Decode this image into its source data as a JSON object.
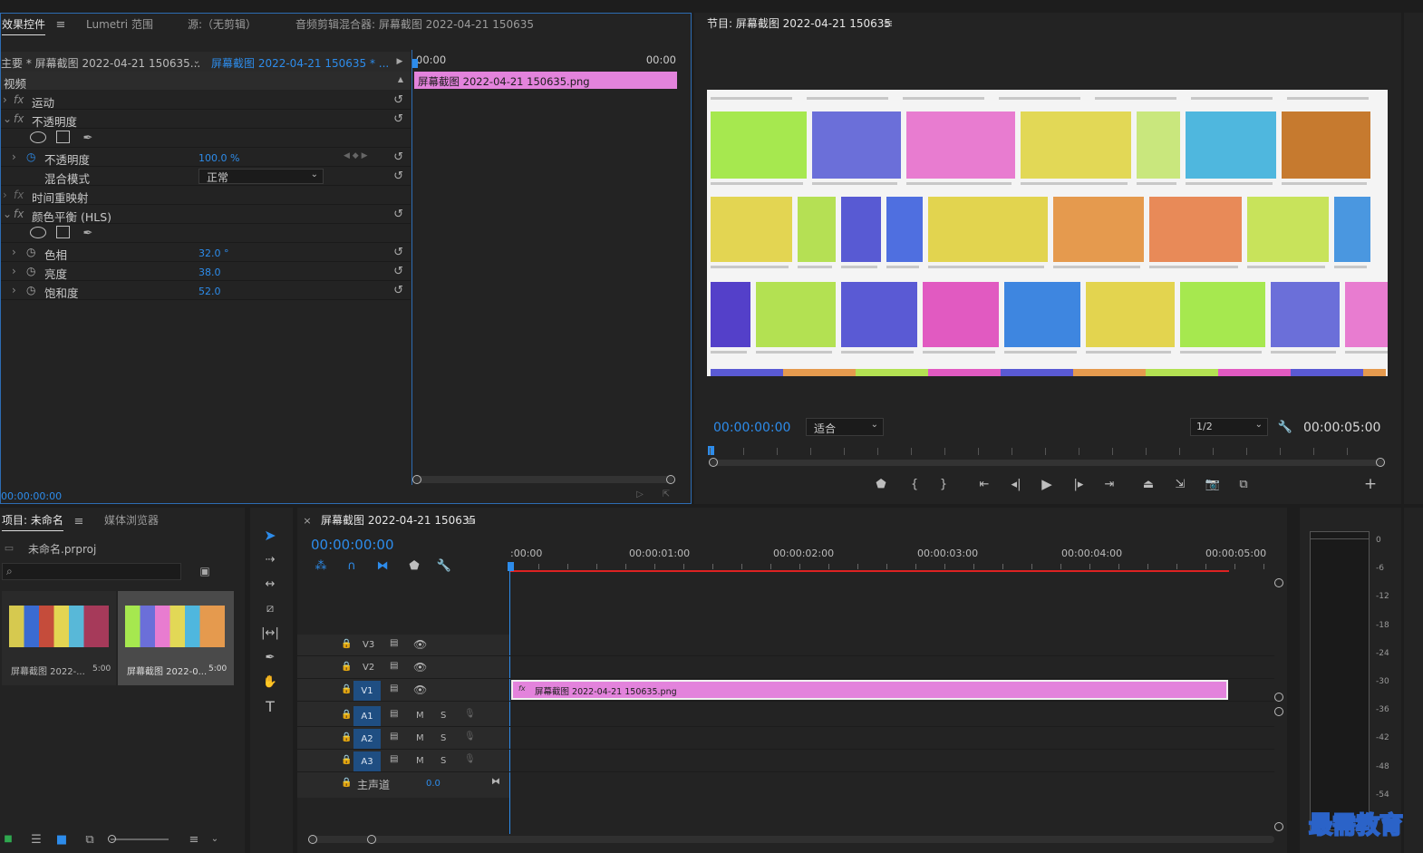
{
  "effect_controls": {
    "tabs": [
      "效果控件",
      "Lumetri 范围",
      "源:（无剪辑）",
      "音频剪辑混合器: 屏幕截图 2022-04-21 150635"
    ],
    "master_label": "主要 * 屏幕截图 2022-04-21 150635...",
    "clip_label": "屏幕截图 2022-04-21 150635 * ...",
    "section_video": "视频",
    "effects": {
      "motion": "运动",
      "opacity": "不透明度",
      "opacity_prop": "不透明度",
      "opacity_value": "100.0 %",
      "blend_mode_label": "混合模式",
      "blend_mode_value": "正常",
      "time_remap": "时间重映射",
      "color_balance": "颜色平衡 (HLS)",
      "hue": "色相",
      "hue_value": "32.0 °",
      "lightness": "亮度",
      "lightness_value": "38.0",
      "saturation": "饱和度",
      "saturation_value": "52.0"
    },
    "mini_timeline": {
      "start": "00:00",
      "end": "00:00",
      "clip": "屏幕截图 2022-04-21 150635.png"
    },
    "timecode": "00:00:00:00"
  },
  "program_monitor": {
    "title": "节目: 屏幕截图 2022-04-21 150635",
    "timecode": "00:00:00:00",
    "fit": "适合",
    "resolution": "1/2",
    "duration": "00:00:05:00",
    "preview_colors": [
      "#a6e84f",
      "#6b6fd9",
      "#e87cd0",
      "#e2d856",
      "#c9e77d",
      "#4fb7de",
      "#c67a2f",
      "#e3d552",
      "#b5e054",
      "#585ad3",
      "#4f6fe0",
      "#e2d44f",
      "#e59a4e",
      "#e88a58",
      "#c8e35b",
      "#4a97e0",
      "#5440c9",
      "#b3e152",
      "#5a5ad4",
      "#e15ac1",
      "#3e86e0",
      "#e3d44f"
    ]
  },
  "project": {
    "tabs": [
      "项目: 未命名",
      "媒体浏览器"
    ],
    "file": "未命名.prproj",
    "items": [
      {
        "name": "屏幕截图 2022-...",
        "duration": "5:00"
      },
      {
        "name": "屏幕截图 2022-0...",
        "duration": "5:00"
      }
    ]
  },
  "timeline": {
    "title": "屏幕截图 2022-04-21 150635",
    "timecode": "00:00:00:00",
    "ruler": [
      ":00:00",
      "00:00:01:00",
      "00:00:02:00",
      "00:00:03:00",
      "00:00:04:00",
      "00:00:05:00"
    ],
    "tracks_video": [
      "V3",
      "V2",
      "V1"
    ],
    "tracks_audio": [
      "A1",
      "A2",
      "A3"
    ],
    "mute": "M",
    "solo": "S",
    "master_track": "主声道",
    "master_value": "0.0",
    "clip": "屏幕截图 2022-04-21 150635.png"
  },
  "meter": {
    "labels": [
      "0",
      "-6",
      "-12",
      "-18",
      "-24",
      "-30",
      "-36",
      "-42",
      "-48",
      "-54"
    ]
  },
  "watermark": "最需教育",
  "accent": "#2d8ceb",
  "clip_color": "#e383dc"
}
